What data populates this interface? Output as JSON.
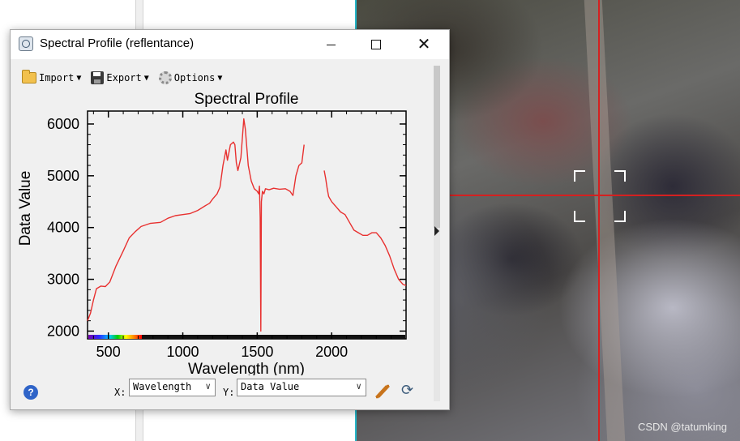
{
  "window": {
    "title": "Spectral Profile (reflentance)",
    "minimize_icon": "minimize-icon",
    "maximize_icon": "maximize-icon",
    "close_icon": "close-icon",
    "close_glyph": "✕"
  },
  "toolbar": {
    "import_label": "Import",
    "export_label": "Export",
    "options_label": "Options",
    "dropdown_glyph": "▼"
  },
  "chart_data": {
    "type": "line",
    "title": "Spectral Profile",
    "xlabel": "Wavelength (nm)",
    "ylabel": "Data Value",
    "xlim": [
      360,
      2500
    ],
    "ylim": [
      1850,
      6250
    ],
    "xticks": [
      500,
      1000,
      1500,
      2000
    ],
    "yticks": [
      2000,
      3000,
      4000,
      5000,
      6000
    ],
    "grid": false,
    "line_color": "#e8302f",
    "segments": [
      [
        [
          360,
          2200
        ],
        [
          380,
          2350
        ],
        [
          400,
          2600
        ],
        [
          420,
          2820
        ],
        [
          450,
          2870
        ],
        [
          480,
          2860
        ],
        [
          510,
          2950
        ],
        [
          550,
          3250
        ],
        [
          600,
          3550
        ],
        [
          640,
          3800
        ],
        [
          680,
          3920
        ],
        [
          720,
          4020
        ],
        [
          780,
          4080
        ],
        [
          850,
          4100
        ],
        [
          900,
          4180
        ],
        [
          950,
          4230
        ],
        [
          1000,
          4250
        ],
        [
          1050,
          4270
        ],
        [
          1100,
          4330
        ],
        [
          1150,
          4420
        ],
        [
          1180,
          4470
        ],
        [
          1200,
          4550
        ],
        [
          1230,
          4650
        ],
        [
          1250,
          4780
        ],
        [
          1270,
          5200
        ],
        [
          1290,
          5500
        ],
        [
          1300,
          5300
        ],
        [
          1320,
          5600
        ],
        [
          1340,
          5650
        ],
        [
          1350,
          5600
        ],
        [
          1360,
          5250
        ],
        [
          1370,
          5100
        ],
        [
          1390,
          5350
        ],
        [
          1410,
          6100
        ],
        [
          1420,
          5900
        ],
        [
          1440,
          5200
        ],
        [
          1460,
          4900
        ],
        [
          1480,
          4750
        ],
        [
          1500,
          4700
        ],
        [
          1510,
          4650
        ],
        [
          1515,
          4800
        ],
        [
          1520,
          4200
        ],
        [
          1524,
          2000
        ],
        [
          1528,
          4500
        ],
        [
          1535,
          4700
        ],
        [
          1545,
          4650
        ],
        [
          1555,
          4750
        ],
        [
          1580,
          4730
        ],
        [
          1610,
          4760
        ],
        [
          1650,
          4740
        ],
        [
          1690,
          4750
        ],
        [
          1720,
          4700
        ],
        [
          1740,
          4620
        ],
        [
          1760,
          5000
        ],
        [
          1780,
          5200
        ],
        [
          1800,
          5250
        ],
        [
          1815,
          5600
        ]
      ],
      [
        [
          1950,
          5100
        ],
        [
          1960,
          4950
        ],
        [
          1970,
          4750
        ],
        [
          1980,
          4600
        ],
        [
          2000,
          4500
        ],
        [
          2030,
          4400
        ],
        [
          2060,
          4300
        ],
        [
          2090,
          4250
        ],
        [
          2120,
          4100
        ],
        [
          2150,
          3950
        ],
        [
          2180,
          3900
        ],
        [
          2210,
          3850
        ],
        [
          2240,
          3850
        ],
        [
          2270,
          3900
        ],
        [
          2300,
          3900
        ],
        [
          2330,
          3800
        ],
        [
          2360,
          3650
        ],
        [
          2390,
          3450
        ],
        [
          2420,
          3200
        ],
        [
          2450,
          3000
        ],
        [
          2480,
          2900
        ],
        [
          2500,
          2880
        ]
      ]
    ]
  },
  "controls": {
    "help_glyph": "?",
    "x_axis_prefix": "X:",
    "y_axis_prefix": "Y:",
    "x_select_value": "Wavelength",
    "y_select_value": "Data Value",
    "select_arrow_glyph": "∨",
    "refresh_glyph": "⟳"
  },
  "background": {
    "watermark": "CSDN @tatumking",
    "crosshair_color": "#d42020"
  }
}
